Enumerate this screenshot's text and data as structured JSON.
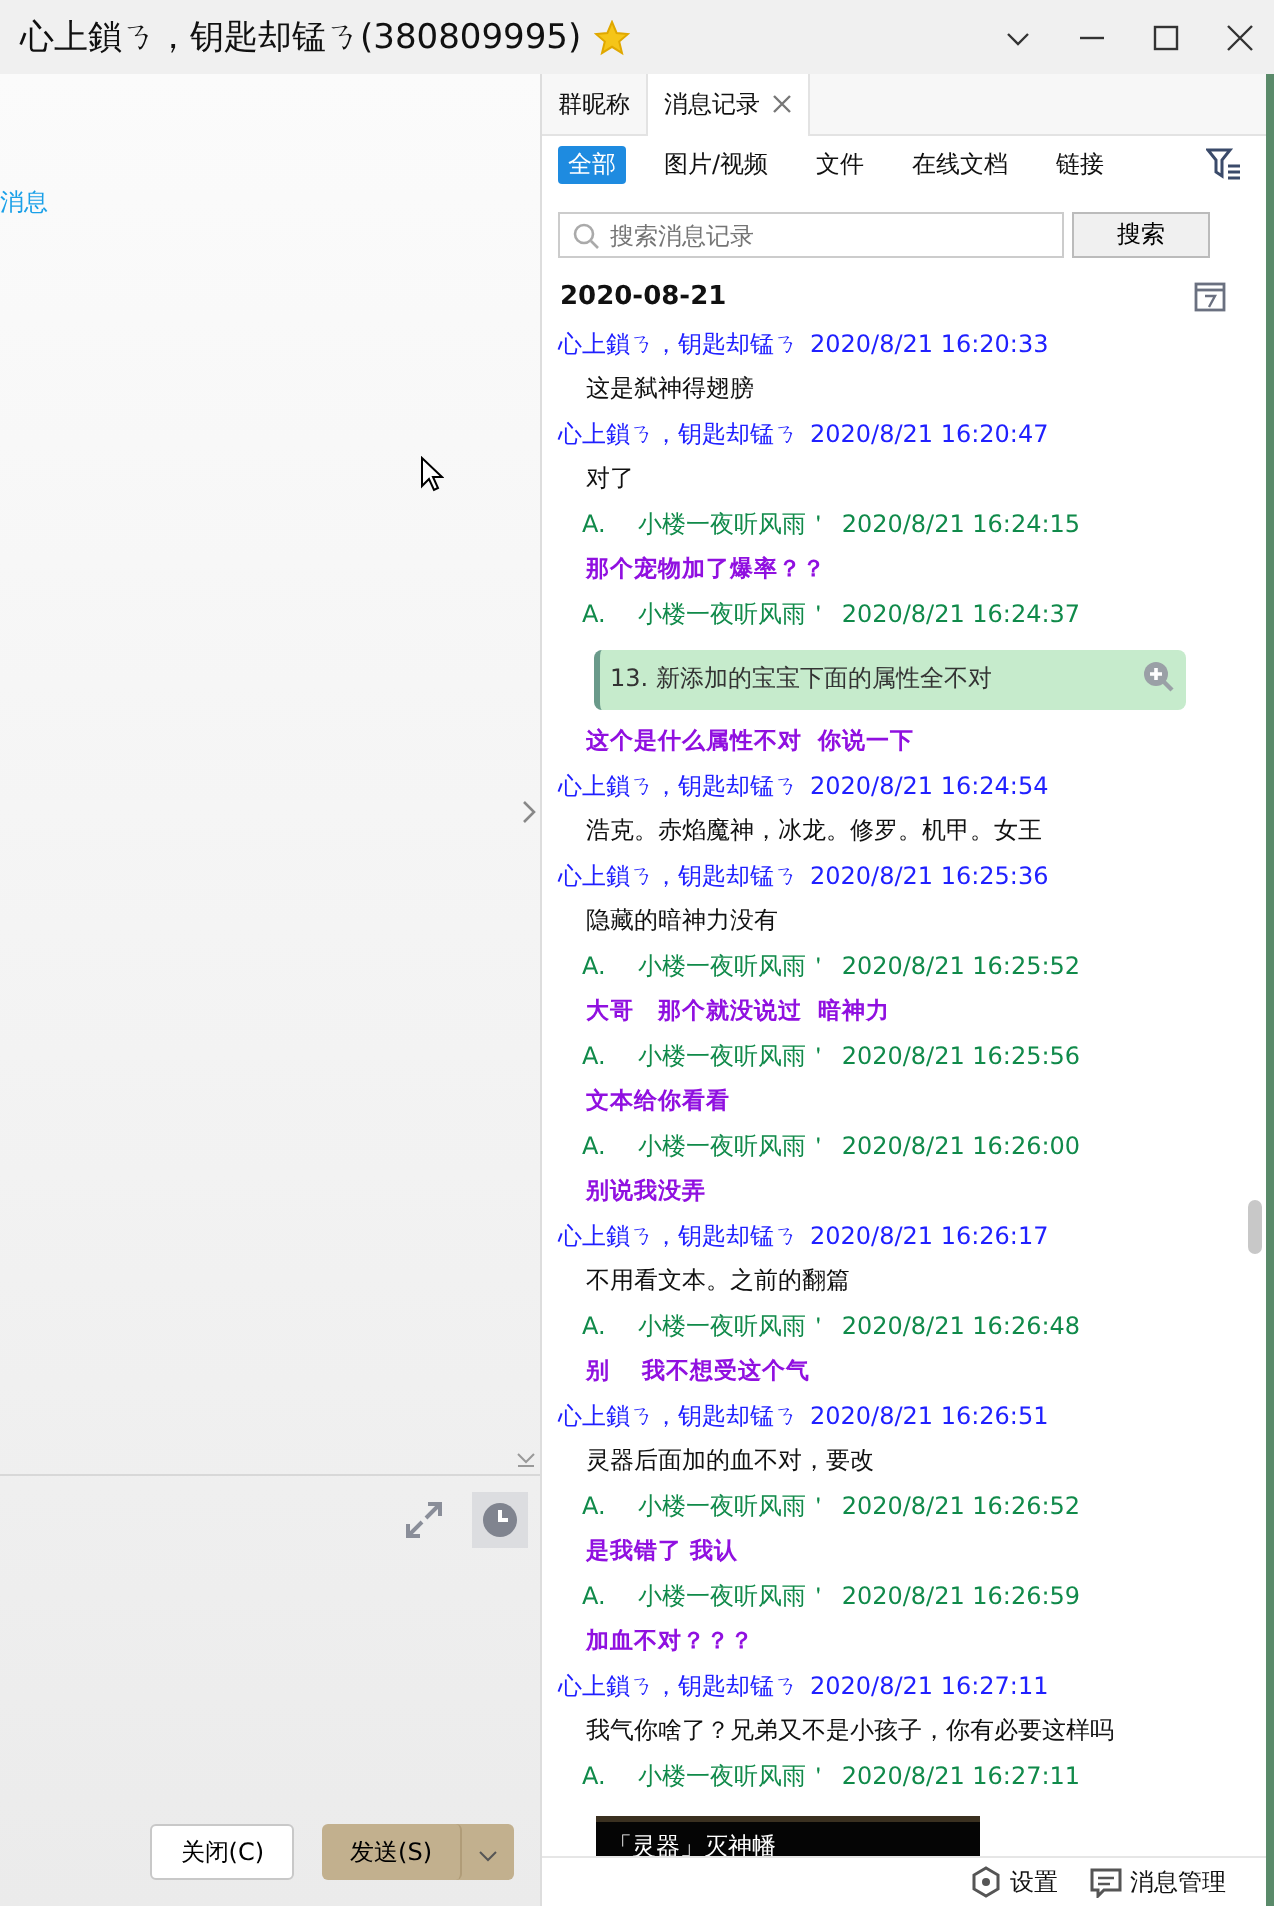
{
  "window": {
    "title": "心上鎖ㄋ，钥匙却锰ㄋ(380809995)"
  },
  "left_pane": {
    "link": "消息",
    "buttons": [
      {
        "label": "关闭(C)",
        "kind": "plain"
      },
      {
        "label": "发送(S)",
        "kind": "primary"
      }
    ]
  },
  "side_tabs": [
    {
      "label": "群昵称",
      "selected": false,
      "closable": false
    },
    {
      "label": "消息记录",
      "selected": true,
      "closable": true
    }
  ],
  "filters": [
    {
      "label": "全部",
      "selected": true
    },
    {
      "label": "图片/视频",
      "selected": false
    },
    {
      "label": "文件",
      "selected": false
    },
    {
      "label": "在线文档",
      "selected": false
    },
    {
      "label": "链接",
      "selected": false
    }
  ],
  "search": {
    "placeholder": "搜索消息记录",
    "button": "搜索"
  },
  "date": "2020-08-21",
  "messages": [
    {
      "sender": "心上鎖ㄋ，钥匙却锰ㄋ",
      "time": "2020/8/21 16:20:33",
      "color": "#2020ff",
      "body": [
        {
          "kind": "plain",
          "text": "这是弑神得翅膀"
        }
      ]
    },
    {
      "sender": "心上鎖ㄋ，钥匙却锰ㄋ",
      "time": "2020/8/21 16:20:47",
      "color": "#2020ff",
      "body": [
        {
          "kind": "plain",
          "text": "对了"
        }
      ]
    },
    {
      "prefix": "A.",
      "sender": "小楼一夜听风雨＇",
      "time": "2020/8/21 16:24:15",
      "color": "#108a4a",
      "body": [
        {
          "kind": "bold",
          "text": "那个宠物加了爆率？？"
        }
      ]
    },
    {
      "prefix": "A.",
      "sender": "小楼一夜听风雨＇",
      "time": "2020/8/21 16:24:37",
      "color": "#108a4a",
      "body": [
        {
          "kind": "quote",
          "text": "13. 新添加的宝宝下面的属性全不对"
        },
        {
          "kind": "bold",
          "text": "这个是什么属性不对  你说一下"
        }
      ]
    },
    {
      "sender": "心上鎖ㄋ，钥匙却锰ㄋ",
      "time": "2020/8/21 16:24:54",
      "color": "#2020ff",
      "body": [
        {
          "kind": "plain",
          "text": "浩克。赤焰魔神，冰龙。修罗。机甲。女王"
        }
      ]
    },
    {
      "sender": "心上鎖ㄋ，钥匙却锰ㄋ",
      "time": "2020/8/21 16:25:36",
      "color": "#2020ff",
      "body": [
        {
          "kind": "plain",
          "text": "隐藏的暗神力没有"
        }
      ]
    },
    {
      "prefix": "A.",
      "sender": "小楼一夜听风雨＇",
      "time": "2020/8/21 16:25:52",
      "color": "#108a4a",
      "body": [
        {
          "kind": "bold",
          "text": "大哥   那个就没说过  暗神力"
        }
      ]
    },
    {
      "prefix": "A.",
      "sender": "小楼一夜听风雨＇",
      "time": "2020/8/21 16:25:56",
      "color": "#108a4a",
      "body": [
        {
          "kind": "bold",
          "text": "文本给你看看"
        }
      ]
    },
    {
      "prefix": "A.",
      "sender": "小楼一夜听风雨＇",
      "time": "2020/8/21 16:26:00",
      "color": "#108a4a",
      "body": [
        {
          "kind": "bold",
          "text": "别说我没弄"
        }
      ]
    },
    {
      "sender": "心上鎖ㄋ，钥匙却锰ㄋ",
      "time": "2020/8/21 16:26:17",
      "color": "#2020ff",
      "body": [
        {
          "kind": "plain",
          "text": "不用看文本。之前的翻篇"
        }
      ]
    },
    {
      "prefix": "A.",
      "sender": "小楼一夜听风雨＇",
      "time": "2020/8/21 16:26:48",
      "color": "#108a4a",
      "body": [
        {
          "kind": "bold",
          "text": "别    我不想受这个气"
        }
      ]
    },
    {
      "sender": "心上鎖ㄋ，钥匙却锰ㄋ",
      "time": "2020/8/21 16:26:51",
      "color": "#2020ff",
      "body": [
        {
          "kind": "plain",
          "text": "灵器后面加的血不对，要改"
        }
      ]
    },
    {
      "prefix": "A.",
      "sender": "小楼一夜听风雨＇",
      "time": "2020/8/21 16:26:52",
      "color": "#108a4a",
      "body": [
        {
          "kind": "bold",
          "text": "是我错了 我认"
        }
      ]
    },
    {
      "prefix": "A.",
      "sender": "小楼一夜听风雨＇",
      "time": "2020/8/21 16:26:59",
      "color": "#108a4a",
      "body": [
        {
          "kind": "bold",
          "text": "加血不对？？？"
        }
      ]
    },
    {
      "sender": "心上鎖ㄋ，钥匙却锰ㄋ",
      "time": "2020/8/21 16:27:11",
      "color": "#2020ff",
      "body": [
        {
          "kind": "plain",
          "text": "我气你啥了？兄弟又不是小孩子，你有必要这样吗"
        }
      ]
    },
    {
      "prefix": "A.",
      "sender": "小楼一夜听风雨＇",
      "time": "2020/8/21 16:27:11",
      "color": "#108a4a",
      "body": [
        {
          "kind": "image",
          "text": "「灵器」灭神幡"
        }
      ]
    }
  ],
  "footer": [
    "设置",
    "消息管理"
  ]
}
